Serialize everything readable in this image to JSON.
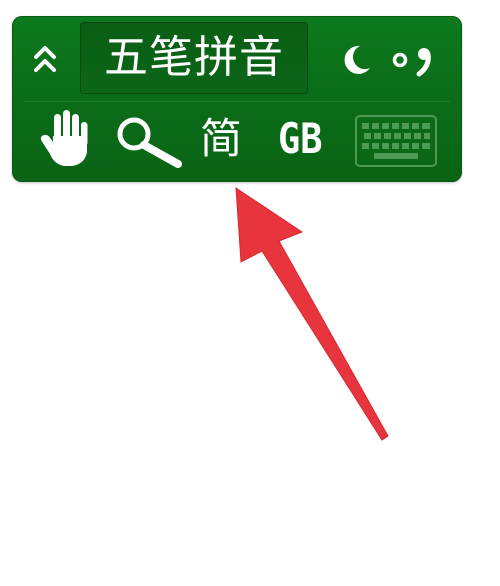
{
  "ime_toolbar": {
    "accent_color": "#0b6d18",
    "collapse_icon": "double-chevron-up-icon",
    "mode_label": "五笔拼音",
    "half_width_icon": "crescent-moon-icon",
    "punctuation_icon": "chinese-punctuation-icon",
    "gesture_icon": "hand-icon",
    "search_icon": "magnifier-icon",
    "simplified_label": "简",
    "charset_label": "GB",
    "keyboard_icon": "soft-keyboard-icon"
  },
  "annotation": {
    "arrow_color": "#e8343c",
    "arrow_icon": "red-pointer-arrow"
  }
}
